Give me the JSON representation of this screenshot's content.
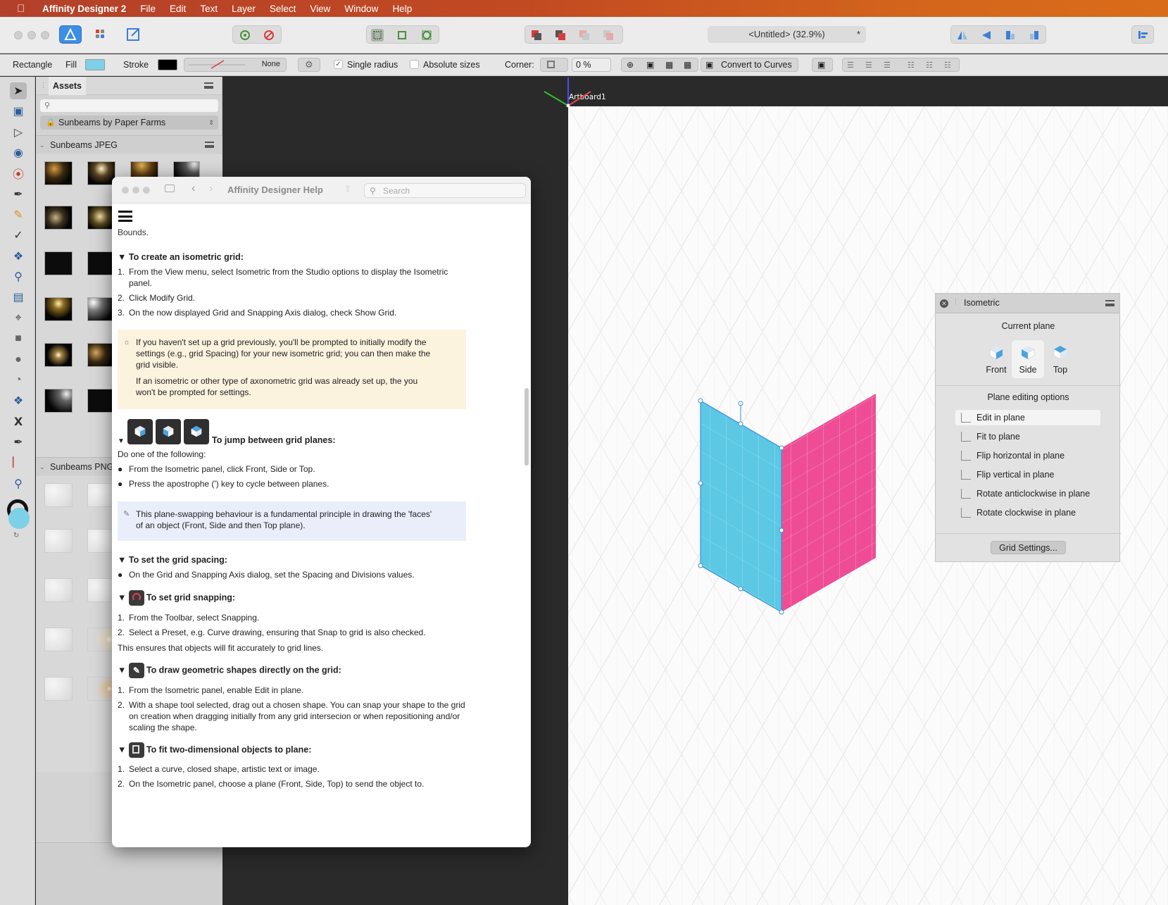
{
  "menubar": {
    "app_name": "Affinity Designer 2",
    "items": [
      "File",
      "Edit",
      "Text",
      "Layer",
      "Select",
      "View",
      "Window",
      "Help"
    ]
  },
  "toolbar": {
    "document_title": "<Untitled> (32.9%)",
    "modified_marker": "*"
  },
  "context_bar": {
    "tool_name": "Rectangle",
    "fill_label": "Fill",
    "fill_color": "#7ed0e6",
    "stroke_label": "Stroke",
    "stroke_color": "#000000",
    "stroke_value": "None",
    "single_radius_label": "Single radius",
    "single_radius_checked": true,
    "absolute_sizes_label": "Absolute sizes",
    "absolute_sizes_checked": false,
    "corner_label": "Corner:",
    "corner_value": "0 %",
    "convert_label": "Convert to Curves"
  },
  "assets": {
    "tab": "Assets",
    "search_placeholder": "",
    "category": "Sunbeams by Paper Farms",
    "group1": "Sunbeams JPEG",
    "group2": "Sunbeams PNG"
  },
  "canvas": {
    "artboard_label": "Artboard1",
    "side_color": "#5cc8e4",
    "pink_color": "#ee4d95"
  },
  "help": {
    "title": "Affinity Designer Help",
    "search_placeholder": "Search",
    "cut_text": "Bounds.",
    "sec1": {
      "title": "To create an isometric grid:",
      "steps": [
        "From the View menu, select Isometric from the Studio options to display the Isometric",
        "panel.",
        "Click Modify Grid.",
        "On the now displayed Grid and Snapping Axis dialog, check Show Grid."
      ]
    },
    "tip": {
      "p1a": "If you haven't set up a grid previously, you'll be prompted to initially modify the",
      "p1b": "settings (e.g., grid Spacing) for your new isometric grid; you can then make the",
      "p1c": "grid visible.",
      "p2a": "If an isometric or other type of axonometric grid was already set up, the you",
      "p2b": "won't be prompted for settings."
    },
    "sec2": {
      "title": "To jump between grid planes:",
      "intro": "Do one of the following:",
      "b1": "From the Isometric panel, click Front, Side or Top.",
      "b2": "Press the apostrophe (') key to cycle between planes."
    },
    "note": {
      "a": "This plane-swapping behaviour is a fundamental principle in drawing the 'faces'",
      "b": "of an object (Front, Side and then Top plane)."
    },
    "sec3": {
      "title": "To set the grid spacing:",
      "b1": "On the Grid and Snapping Axis dialog, set the Spacing and Divisions values."
    },
    "sec4": {
      "title": "To set grid snapping:",
      "s1": "From the Toolbar, select Snapping.",
      "s2": "Select a Preset, e.g. Curve drawing, ensuring that Snap to grid is also checked.",
      "after": "This ensures that objects will fit accurately to grid lines."
    },
    "sec5": {
      "title": "To draw geometric shapes directly on the grid:",
      "s1": "From the Isometric panel, enable Edit in plane.",
      "s2a": "With a shape tool selected, drag out a chosen shape. You can snap your shape to the grid",
      "s2b": "on creation when dragging initially from any grid intersecion or when repositioning and/or",
      "s2c": "scaling the shape."
    },
    "sec6": {
      "title": "To fit two-dimensional objects to plane:",
      "s1": "Select a curve, closed shape, artistic text or image.",
      "s2": "On the Isometric panel, choose a plane (Front, Side, Top) to send the object to."
    }
  },
  "iso_panel": {
    "title": "Isometric",
    "current_plane": "Current plane",
    "planes": [
      "Front",
      "Side",
      "Top"
    ],
    "active_plane": "Side",
    "options_title": "Plane editing options",
    "options": [
      "Edit in plane",
      "Fit to plane",
      "Flip horizontal in plane",
      "Flip vertical in plane",
      "Rotate anticlockwise in plane",
      "Rotate clockwise in plane"
    ],
    "grid_button": "Grid Settings..."
  }
}
